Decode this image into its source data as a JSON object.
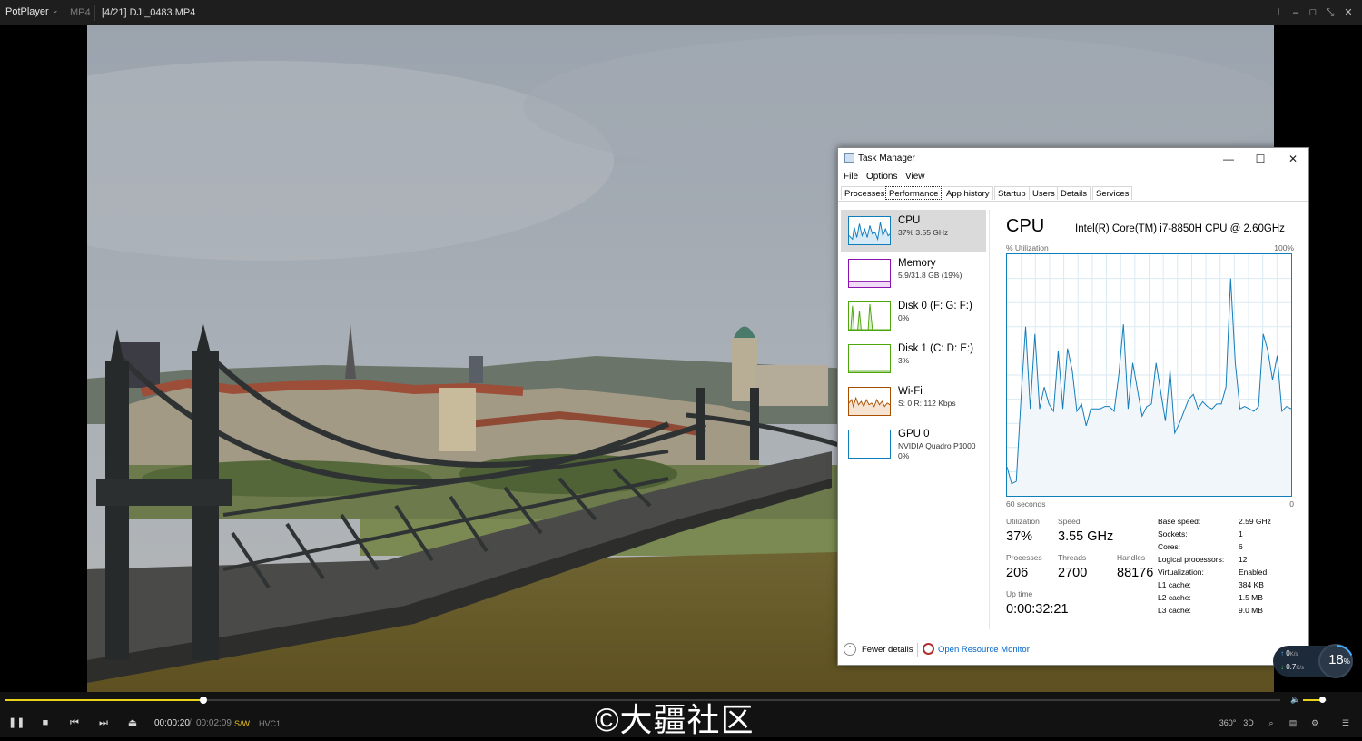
{
  "player": {
    "brand": "PotPlayer",
    "format": "MP4",
    "file_title": "[4/21] DJI_0483.MP4",
    "time_current": "00:00:20",
    "time_separator": "/",
    "time_total": "00:02:09",
    "tag_sw": "S/W",
    "tag_codec": "HVC1",
    "seek_progress": 0.155,
    "volume_level": 0.8,
    "watermark": "©大疆社区",
    "right_buttons": [
      "360°",
      "3D"
    ]
  },
  "gauge": {
    "up": "0",
    "up_unit": "K/s",
    "down": "0.7",
    "down_unit": "K/s",
    "percent": "18",
    "percent_unit": "%"
  },
  "task_manager": {
    "title": "Task Manager",
    "menu": [
      "File",
      "Options",
      "View"
    ],
    "tabs": [
      "Processes",
      "Performance",
      "App history",
      "Startup",
      "Users",
      "Details",
      "Services"
    ],
    "active_tab": "Performance",
    "sidebar": [
      {
        "name": "CPU",
        "value": "37% 3.55 GHz",
        "value2": "",
        "color": "#117dbb"
      },
      {
        "name": "Memory",
        "value": "5.9/31.8 GB (19%)",
        "value2": "",
        "color": "#8b12ae"
      },
      {
        "name": "Disk 0 (F: G: F:)",
        "value": "0%",
        "value2": "",
        "color": "#4da60c"
      },
      {
        "name": "Disk 1 (C: D: E:)",
        "value": "3%",
        "value2": "",
        "color": "#4da60c"
      },
      {
        "name": "Wi-Fi",
        "value": "S: 0  R: 112 Kbps",
        "value2": "",
        "color": "#a74f01"
      },
      {
        "name": "GPU 0",
        "value": "NVIDIA Quadro P1000",
        "value2": "0%",
        "color": "#117dbb"
      }
    ],
    "main": {
      "heading": "CPU",
      "model": "Intel(R) Core(TM) i7-8850H CPU @ 2.60GHz",
      "util_label": "% Utilization",
      "util_max": "100%",
      "axis_left": "60 seconds",
      "axis_right": "0",
      "utilization_label": "Utilization",
      "utilization": "37%",
      "speed_label": "Speed",
      "speed": "3.55 GHz",
      "processes_label": "Processes",
      "processes": "206",
      "threads_label": "Threads",
      "threads": "2700",
      "handles_label": "Handles",
      "handles": "88176",
      "uptime_label": "Up time",
      "uptime": "0:00:32:21",
      "specs": [
        {
          "label": "Base speed:",
          "value": "2.59 GHz"
        },
        {
          "label": "Sockets:",
          "value": "1"
        },
        {
          "label": "Cores:",
          "value": "6"
        },
        {
          "label": "Logical processors:",
          "value": "12"
        },
        {
          "label": "Virtualization:",
          "value": "Enabled"
        },
        {
          "label": "L1 cache:",
          "value": "384 KB"
        },
        {
          "label": "L2 cache:",
          "value": "1.5 MB"
        },
        {
          "label": "L3 cache:",
          "value": "9.0 MB"
        }
      ],
      "cpu_history": [
        12,
        5,
        6,
        40,
        70,
        36,
        67,
        36,
        45,
        38,
        35,
        60,
        36,
        61,
        52,
        35,
        38,
        29,
        36,
        36,
        36,
        37,
        37,
        35,
        50,
        71,
        36,
        55,
        44,
        33,
        37,
        38,
        55,
        43,
        31,
        52,
        26,
        30,
        35,
        40,
        42,
        36,
        39,
        37,
        36,
        38,
        38,
        45,
        90,
        55,
        36,
        37,
        36,
        35,
        37,
        67,
        60,
        48,
        58,
        35,
        37,
        36
      ]
    },
    "footer": {
      "fewer_details": "Fewer details",
      "resource_monitor": "Open Resource Monitor"
    }
  }
}
